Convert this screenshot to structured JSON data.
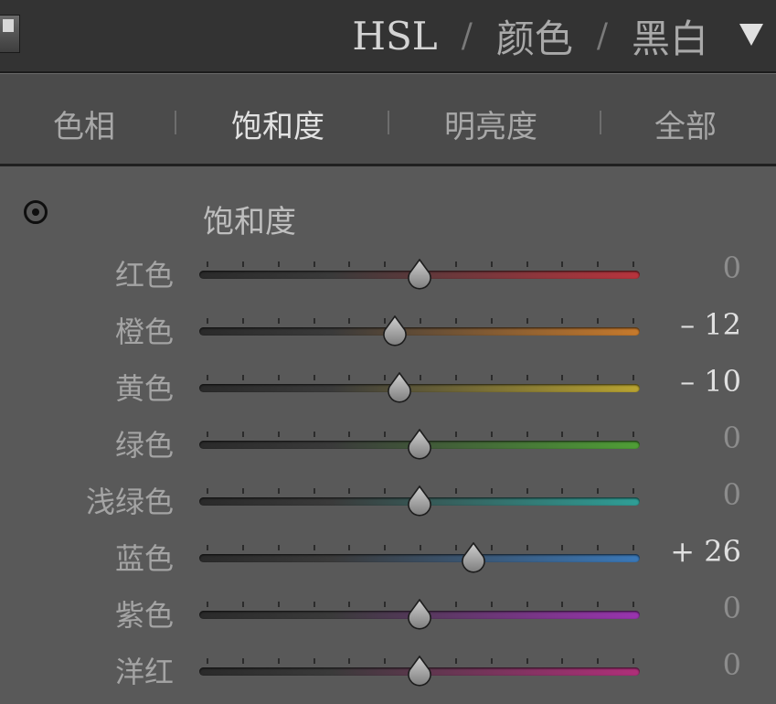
{
  "header": {
    "titles": [
      "HSL",
      "颜色",
      "黑白"
    ],
    "separator": "/"
  },
  "tabs": [
    "色相",
    "饱和度",
    "明亮度",
    "全部"
  ],
  "active_tab": 1,
  "section_title": "饱和度",
  "slider_range": [
    -100,
    100
  ],
  "sliders": [
    {
      "label": "红色",
      "value": 0,
      "display": "0",
      "color": "#b8343d"
    },
    {
      "label": "橙色",
      "value": -12,
      "display": "– 12",
      "color": "#c77a2c"
    },
    {
      "label": "黄色",
      "value": -10,
      "display": "– 10",
      "color": "#b9a431"
    },
    {
      "label": "绿色",
      "value": 0,
      "display": "0",
      "color": "#4f9f36"
    },
    {
      "label": "浅绿色",
      "value": 0,
      "display": "0",
      "color": "#2f9f97"
    },
    {
      "label": "蓝色",
      "value": 26,
      "display": "+ 26",
      "color": "#3a78b8"
    },
    {
      "label": "紫色",
      "value": 0,
      "display": "0",
      "color": "#9a34b0"
    },
    {
      "label": "洋红",
      "value": 0,
      "display": "0",
      "color": "#b02f7a"
    }
  ]
}
